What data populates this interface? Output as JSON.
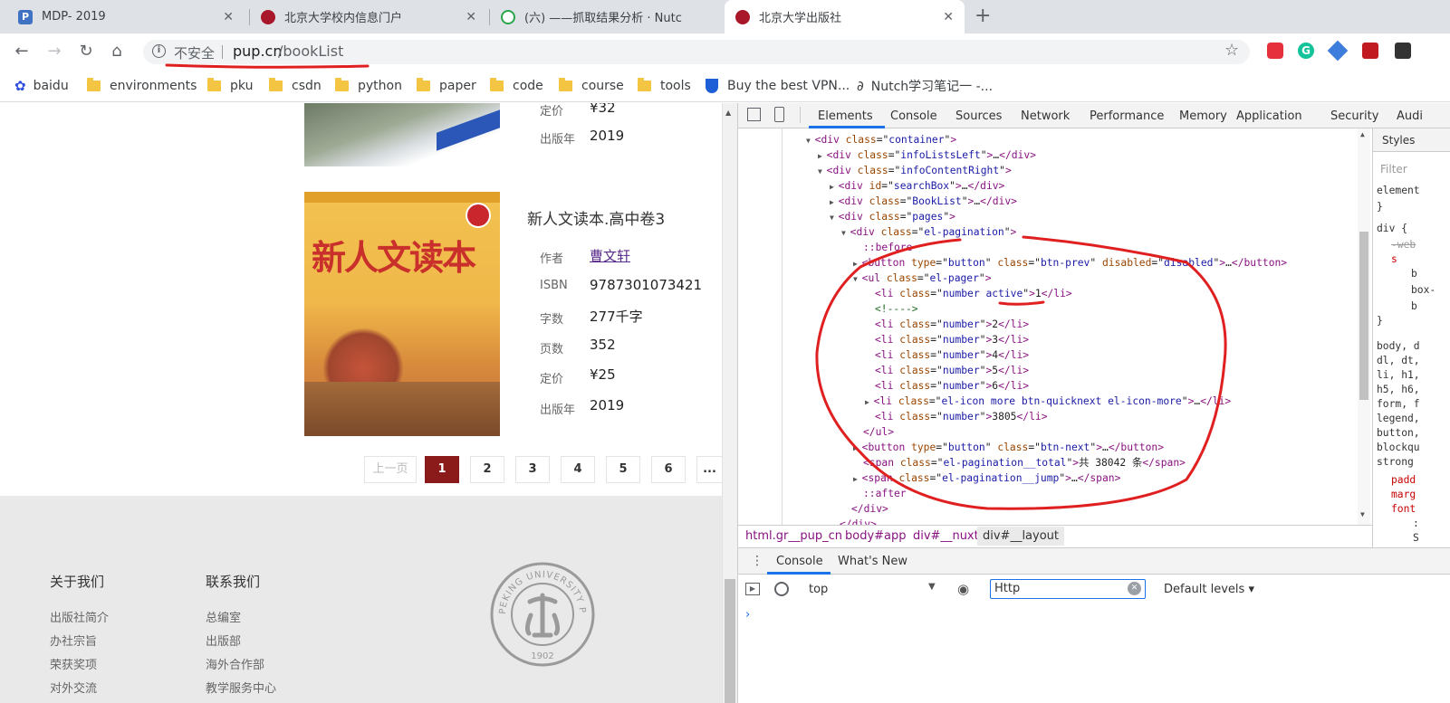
{
  "tabs": [
    {
      "title": "MDP- 2019",
      "color": "#3f72c2",
      "glyph": "P"
    },
    {
      "title": "北京大学校内信息门户",
      "color": "#a8182a",
      "glyph": ""
    },
    {
      "title": "(六) ——抓取结果分析 · Nutc",
      "color": "#2aa64a",
      "glyph": ""
    },
    {
      "title": "北京大学出版社",
      "color": "#a8182a",
      "glyph": ""
    }
  ],
  "address": {
    "security": "不安全",
    "host": "pup.cn",
    "path": "/bookList"
  },
  "bookmarks": [
    "baidu",
    "environments",
    "pku",
    "csdn",
    "python",
    "paper",
    "code",
    "course",
    "tools",
    "Buy the best VPN...",
    "Nutch学习笔记一 -..."
  ],
  "book_prev": {
    "labels": [
      "定价",
      "出版年"
    ],
    "values": [
      "¥32",
      "2019"
    ]
  },
  "book": {
    "title": "新人文读本.高中卷3",
    "cover_text": "新人文读本",
    "rows": [
      {
        "label": "作者",
        "value": "曹文轩"
      },
      {
        "label": "ISBN",
        "value": "9787301073421"
      },
      {
        "label": "字数",
        "value": "277千字"
      },
      {
        "label": "页数",
        "value": "352"
      },
      {
        "label": "定价",
        "value": "¥25"
      },
      {
        "label": "出版年",
        "value": "2019"
      }
    ]
  },
  "pagination": {
    "prev": "上一页",
    "pages": [
      "1",
      "2",
      "3",
      "4",
      "5",
      "6"
    ],
    "more": "..."
  },
  "footer": {
    "col1_title": "关于我们",
    "col1": [
      "出版社简介",
      "办社宗旨",
      "荣获奖项",
      "对外交流"
    ],
    "col2_title": "联系我们",
    "col2": [
      "总编室",
      "出版部",
      "海外合作部",
      "教学服务中心"
    ],
    "seal_text": "PEKING UNIVERSITY PRESS",
    "seal_year": "1902"
  },
  "devtools": {
    "tabs": [
      "Elements",
      "Console",
      "Sources",
      "Network",
      "Performance",
      "Memory",
      "Application",
      "Security",
      "Audi"
    ],
    "side_tab": "Styles",
    "filter": "Filter",
    "crumbs": [
      "html.gr__pup_cn",
      "body#app",
      "div#__nuxt",
      "div#__layout"
    ],
    "drawer_tabs": [
      "Console",
      "What's New"
    ],
    "context": "top",
    "console_filter": "Http",
    "levels": "Default levels ▾",
    "styles_lines": [
      "element",
      "}",
      "div {",
      "-web",
      "s",
      "b",
      "box-",
      "b",
      "}",
      "body, d",
      "dl, dt,",
      "li, h1,",
      "h5, h6,",
      "form, f",
      "legend,",
      "button,",
      "blockqu",
      "strong ",
      "padd",
      "marg",
      "font",
      ":",
      "S"
    ]
  },
  "dom_lines": [
    {
      "indent": 0,
      "arrow": "▼",
      "tag": "div",
      "attrs": [
        [
          "class",
          "container"
        ]
      ],
      "tail": ">"
    },
    {
      "indent": 1,
      "arrow": "▶",
      "tag": "div",
      "attrs": [
        [
          "class",
          "infoListsLeft"
        ]
      ],
      "tail": ">…</div>"
    },
    {
      "indent": 1,
      "arrow": "▼",
      "tag": "div",
      "attrs": [
        [
          "class",
          "infoContentRight"
        ]
      ],
      "tail": ">"
    },
    {
      "indent": 2,
      "arrow": "▶",
      "tag": "div",
      "attrs": [
        [
          "id",
          "searchBox"
        ]
      ],
      "tail": ">…</div>"
    },
    {
      "indent": 2,
      "arrow": "▶",
      "tag": "div",
      "attrs": [
        [
          "class",
          "BookList"
        ]
      ],
      "tail": ">…</div>"
    },
    {
      "indent": 2,
      "arrow": "▼",
      "tag": "div",
      "attrs": [
        [
          "class",
          "pages"
        ]
      ],
      "tail": ">"
    },
    {
      "indent": 3,
      "arrow": "▼",
      "tag": "div",
      "attrs": [
        [
          "class",
          "el-pagination"
        ]
      ],
      "tail": ">"
    },
    {
      "indent": 4,
      "pseudo": "::before"
    },
    {
      "indent": 4,
      "arrow": "▶",
      "tag": "button",
      "attrs": [
        [
          "type",
          "button"
        ],
        [
          "class",
          "btn-prev"
        ],
        [
          "disabled",
          "disabled"
        ]
      ],
      "tail": ">…</button>"
    },
    {
      "indent": 4,
      "arrow": "▼",
      "tag": "ul",
      "attrs": [
        [
          "class",
          "el-pager"
        ]
      ],
      "tail": ">"
    },
    {
      "indent": 5,
      "tag": "li",
      "attrs": [
        [
          "class",
          "number active"
        ]
      ],
      "tail": ">1</li>"
    },
    {
      "indent": 5,
      "comment": "<!---->"
    },
    {
      "indent": 5,
      "tag": "li",
      "attrs": [
        [
          "class",
          "number"
        ]
      ],
      "tail": ">2</li>"
    },
    {
      "indent": 5,
      "tag": "li",
      "attrs": [
        [
          "class",
          "number"
        ]
      ],
      "tail": ">3</li>"
    },
    {
      "indent": 5,
      "tag": "li",
      "attrs": [
        [
          "class",
          "number"
        ]
      ],
      "tail": ">4</li>"
    },
    {
      "indent": 5,
      "tag": "li",
      "attrs": [
        [
          "class",
          "number"
        ]
      ],
      "tail": ">5</li>"
    },
    {
      "indent": 5,
      "tag": "li",
      "attrs": [
        [
          "class",
          "number"
        ]
      ],
      "tail": ">6</li>"
    },
    {
      "indent": 5,
      "arrow": "▶",
      "tag": "li",
      "attrs": [
        [
          "class",
          "el-icon more btn-quicknext el-icon-more"
        ]
      ],
      "tail": ">…</li>"
    },
    {
      "indent": 5,
      "tag": "li",
      "attrs": [
        [
          "class",
          "number"
        ]
      ],
      "tail": ">3805</li>"
    },
    {
      "indent": 4,
      "close": "</ul>"
    },
    {
      "indent": 4,
      "arrow": "▶",
      "tag": "button",
      "attrs": [
        [
          "type",
          "button"
        ],
        [
          "class",
          "btn-next"
        ]
      ],
      "tail": ">…</button>"
    },
    {
      "indent": 4,
      "tag": "span",
      "attrs": [
        [
          "class",
          "el-pagination__total"
        ]
      ],
      "tail": ">共 38042 条</span>"
    },
    {
      "indent": 4,
      "arrow": "▶",
      "tag": "span",
      "attrs": [
        [
          "class",
          "el-pagination__jump"
        ]
      ],
      "tail": ">…</span>"
    },
    {
      "indent": 4,
      "pseudo": "::after"
    },
    {
      "indent": 3,
      "close": "</div>"
    },
    {
      "indent": 2,
      "close": "</div>"
    }
  ],
  "colors": {
    "accent_red": "#8b1a1a",
    "annotation": "#e02020",
    "devtools_tab": "#1a73e8"
  }
}
